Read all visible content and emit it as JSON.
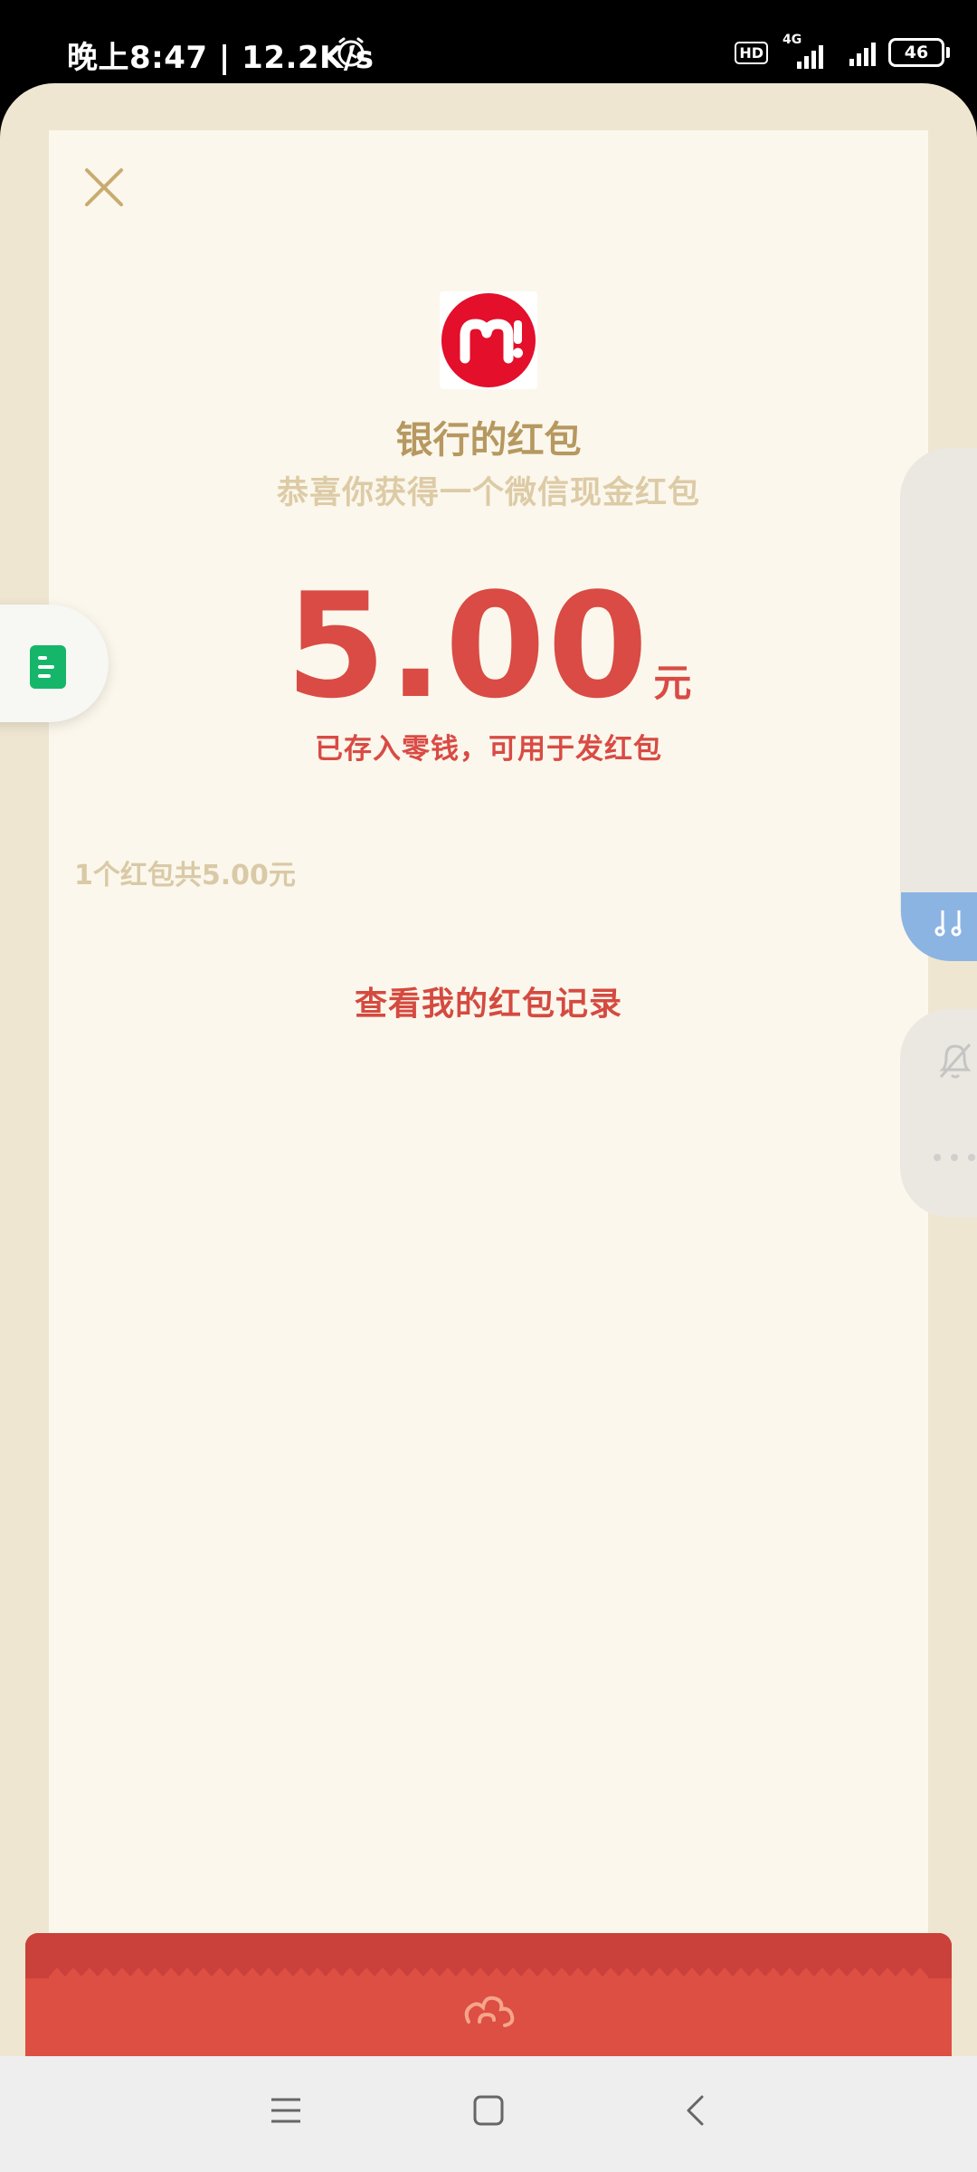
{
  "status_bar": {
    "time": "晚上8:47 | 12.2K/s",
    "hd": "HD",
    "network": "4G",
    "battery": "46"
  },
  "close_icon": "close-icon",
  "sender": "银行的红包",
  "congrats": "恭喜你获得一个微信现金红包",
  "amount": "5.00",
  "unit": "元",
  "deposit": "已存入零钱，可用于发红包",
  "summary": "1个红包共5.00元",
  "records_link": "查看我的红包记录",
  "colors": {
    "accent": "#d94b44",
    "gold": "#b69860",
    "card": "#fbf7ec"
  }
}
